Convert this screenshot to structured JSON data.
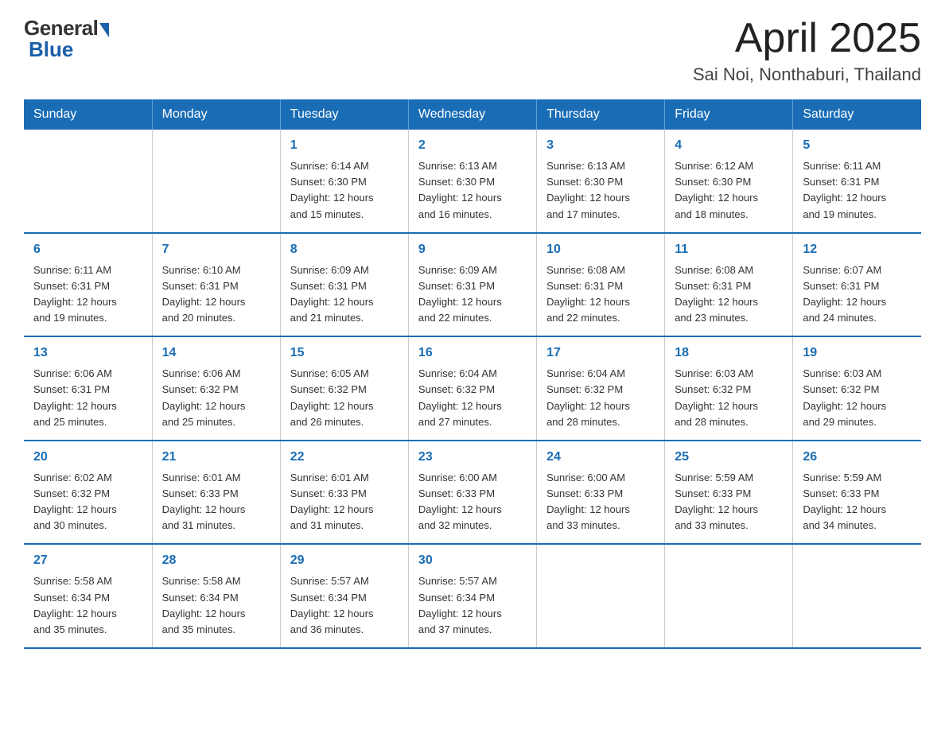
{
  "logo": {
    "general": "General",
    "blue": "Blue"
  },
  "title": "April 2025",
  "subtitle": "Sai Noi, Nonthaburi, Thailand",
  "weekdays": [
    "Sunday",
    "Monday",
    "Tuesday",
    "Wednesday",
    "Thursday",
    "Friday",
    "Saturday"
  ],
  "weeks": [
    [
      {
        "day": "",
        "info": ""
      },
      {
        "day": "",
        "info": ""
      },
      {
        "day": "1",
        "info": "Sunrise: 6:14 AM\nSunset: 6:30 PM\nDaylight: 12 hours\nand 15 minutes."
      },
      {
        "day": "2",
        "info": "Sunrise: 6:13 AM\nSunset: 6:30 PM\nDaylight: 12 hours\nand 16 minutes."
      },
      {
        "day": "3",
        "info": "Sunrise: 6:13 AM\nSunset: 6:30 PM\nDaylight: 12 hours\nand 17 minutes."
      },
      {
        "day": "4",
        "info": "Sunrise: 6:12 AM\nSunset: 6:30 PM\nDaylight: 12 hours\nand 18 minutes."
      },
      {
        "day": "5",
        "info": "Sunrise: 6:11 AM\nSunset: 6:31 PM\nDaylight: 12 hours\nand 19 minutes."
      }
    ],
    [
      {
        "day": "6",
        "info": "Sunrise: 6:11 AM\nSunset: 6:31 PM\nDaylight: 12 hours\nand 19 minutes."
      },
      {
        "day": "7",
        "info": "Sunrise: 6:10 AM\nSunset: 6:31 PM\nDaylight: 12 hours\nand 20 minutes."
      },
      {
        "day": "8",
        "info": "Sunrise: 6:09 AM\nSunset: 6:31 PM\nDaylight: 12 hours\nand 21 minutes."
      },
      {
        "day": "9",
        "info": "Sunrise: 6:09 AM\nSunset: 6:31 PM\nDaylight: 12 hours\nand 22 minutes."
      },
      {
        "day": "10",
        "info": "Sunrise: 6:08 AM\nSunset: 6:31 PM\nDaylight: 12 hours\nand 22 minutes."
      },
      {
        "day": "11",
        "info": "Sunrise: 6:08 AM\nSunset: 6:31 PM\nDaylight: 12 hours\nand 23 minutes."
      },
      {
        "day": "12",
        "info": "Sunrise: 6:07 AM\nSunset: 6:31 PM\nDaylight: 12 hours\nand 24 minutes."
      }
    ],
    [
      {
        "day": "13",
        "info": "Sunrise: 6:06 AM\nSunset: 6:31 PM\nDaylight: 12 hours\nand 25 minutes."
      },
      {
        "day": "14",
        "info": "Sunrise: 6:06 AM\nSunset: 6:32 PM\nDaylight: 12 hours\nand 25 minutes."
      },
      {
        "day": "15",
        "info": "Sunrise: 6:05 AM\nSunset: 6:32 PM\nDaylight: 12 hours\nand 26 minutes."
      },
      {
        "day": "16",
        "info": "Sunrise: 6:04 AM\nSunset: 6:32 PM\nDaylight: 12 hours\nand 27 minutes."
      },
      {
        "day": "17",
        "info": "Sunrise: 6:04 AM\nSunset: 6:32 PM\nDaylight: 12 hours\nand 28 minutes."
      },
      {
        "day": "18",
        "info": "Sunrise: 6:03 AM\nSunset: 6:32 PM\nDaylight: 12 hours\nand 28 minutes."
      },
      {
        "day": "19",
        "info": "Sunrise: 6:03 AM\nSunset: 6:32 PM\nDaylight: 12 hours\nand 29 minutes."
      }
    ],
    [
      {
        "day": "20",
        "info": "Sunrise: 6:02 AM\nSunset: 6:32 PM\nDaylight: 12 hours\nand 30 minutes."
      },
      {
        "day": "21",
        "info": "Sunrise: 6:01 AM\nSunset: 6:33 PM\nDaylight: 12 hours\nand 31 minutes."
      },
      {
        "day": "22",
        "info": "Sunrise: 6:01 AM\nSunset: 6:33 PM\nDaylight: 12 hours\nand 31 minutes."
      },
      {
        "day": "23",
        "info": "Sunrise: 6:00 AM\nSunset: 6:33 PM\nDaylight: 12 hours\nand 32 minutes."
      },
      {
        "day": "24",
        "info": "Sunrise: 6:00 AM\nSunset: 6:33 PM\nDaylight: 12 hours\nand 33 minutes."
      },
      {
        "day": "25",
        "info": "Sunrise: 5:59 AM\nSunset: 6:33 PM\nDaylight: 12 hours\nand 33 minutes."
      },
      {
        "day": "26",
        "info": "Sunrise: 5:59 AM\nSunset: 6:33 PM\nDaylight: 12 hours\nand 34 minutes."
      }
    ],
    [
      {
        "day": "27",
        "info": "Sunrise: 5:58 AM\nSunset: 6:34 PM\nDaylight: 12 hours\nand 35 minutes."
      },
      {
        "day": "28",
        "info": "Sunrise: 5:58 AM\nSunset: 6:34 PM\nDaylight: 12 hours\nand 35 minutes."
      },
      {
        "day": "29",
        "info": "Sunrise: 5:57 AM\nSunset: 6:34 PM\nDaylight: 12 hours\nand 36 minutes."
      },
      {
        "day": "30",
        "info": "Sunrise: 5:57 AM\nSunset: 6:34 PM\nDaylight: 12 hours\nand 37 minutes."
      },
      {
        "day": "",
        "info": ""
      },
      {
        "day": "",
        "info": ""
      },
      {
        "day": "",
        "info": ""
      }
    ]
  ]
}
